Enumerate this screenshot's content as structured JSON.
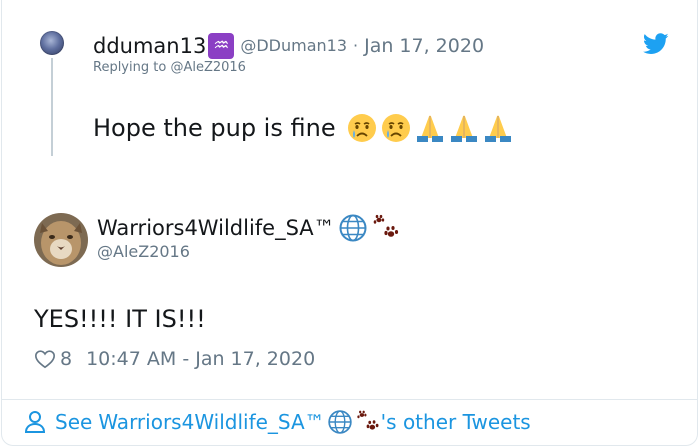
{
  "parent_tweet": {
    "display_name": "dduman13",
    "name_emoji": "♒",
    "handle": "@DDuman13",
    "separator": "·",
    "date": "Jan 17, 2020",
    "replying_prefix": "Replying to",
    "replying_to": "@AleZ2016",
    "text": "Hope the pup is fine",
    "emojis": [
      "crying-face",
      "crying-face",
      "folded-hands",
      "folded-hands",
      "folded-hands"
    ]
  },
  "main_tweet": {
    "display_name": "Warriors4Wildlife_SA™",
    "handle": "@AleZ2016",
    "text": "YES!!!! IT IS!!!",
    "like_count": "8",
    "timestamp": "10:47 AM - Jan 17, 2020"
  },
  "footer": {
    "prefix": "See",
    "name": "Warriors4Wildlife_SA™",
    "suffix": "'s other Tweets"
  },
  "colors": {
    "twitter_blue": "#1da1f2",
    "link_blue": "#1b95e0",
    "muted_text": "#657786",
    "body_text": "#14171a",
    "thread_line": "#c4cfd6",
    "aquarius_purple": "#8b3fc4"
  }
}
